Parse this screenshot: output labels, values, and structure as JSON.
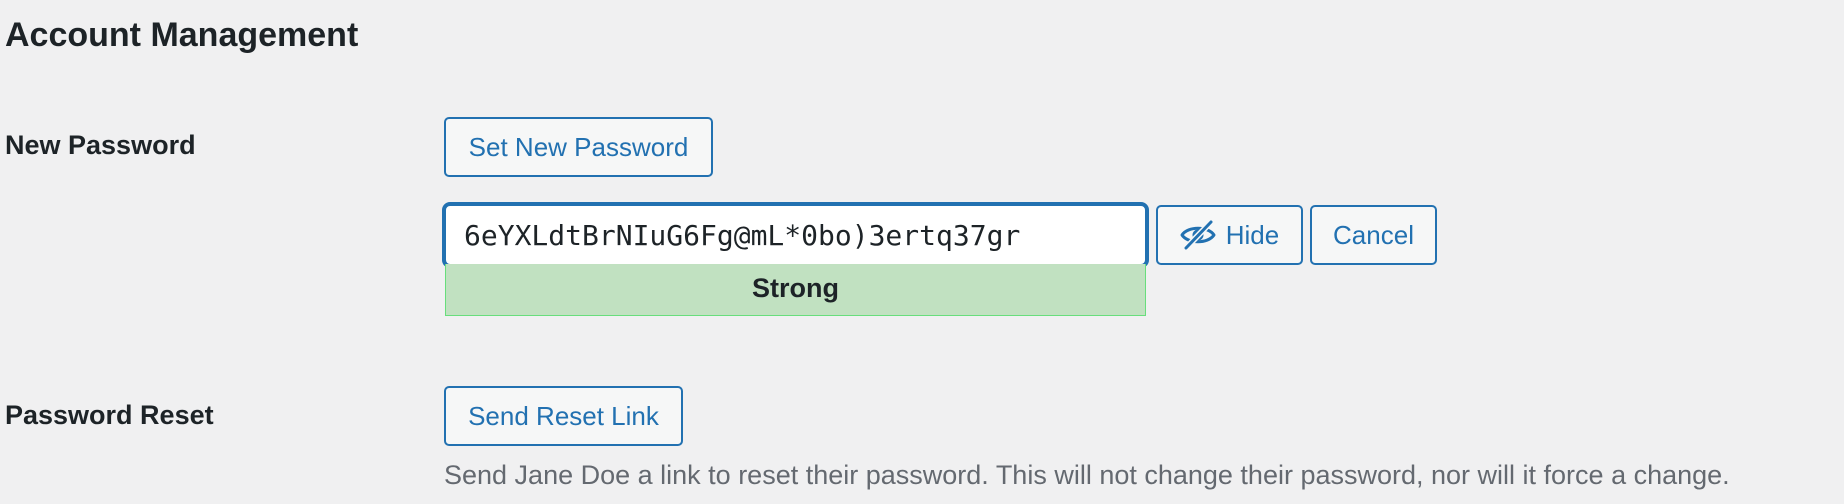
{
  "section": {
    "title": "Account Management"
  },
  "new_password": {
    "label": "New Password",
    "set_button_label": "Set New Password",
    "password_value": "6eYXLdtBrNIuG6Fg@mL*0bo)3ertq37gr",
    "strength_label": "Strong",
    "hide_button_label": "Hide",
    "hide_icon": "eye-slash-icon",
    "cancel_button_label": "Cancel"
  },
  "password_reset": {
    "label": "Password Reset",
    "send_button_label": "Send Reset Link",
    "description": "Send Jane Doe a link to reset their password. This will not change their password, nor will it force a change."
  },
  "colors": {
    "background": "#f0f0f1",
    "accent": "#2271b1",
    "strength_strong_bg": "#c1e1c1",
    "strength_strong_border": "#68de7c",
    "description_text": "#646970"
  }
}
